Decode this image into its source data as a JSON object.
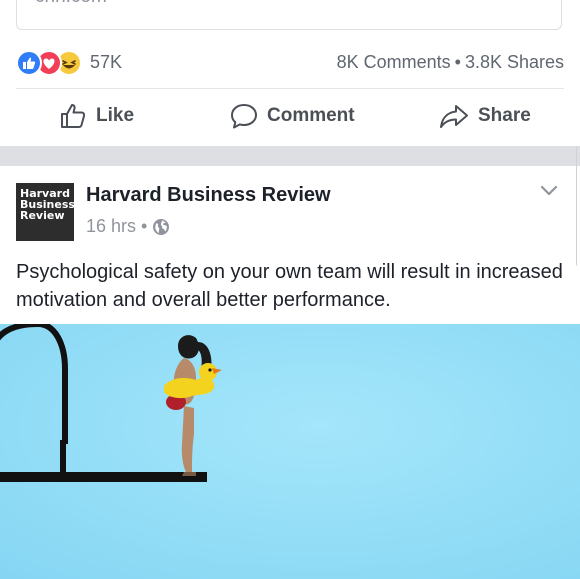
{
  "prev_post": {
    "link_domain": "cnn.com",
    "reaction_count": "57K",
    "comments": "8K Comments",
    "shares": "3.8K Shares",
    "stats_separator": "•"
  },
  "actions": {
    "like": "Like",
    "comment": "Comment",
    "share": "Share"
  },
  "post": {
    "logo_lines": [
      "Harvard",
      "Business",
      "Review"
    ],
    "page_name": "Harvard Business Review",
    "time": "16 hrs",
    "meta_separator": "•",
    "privacy_icon": "globe-icon",
    "text": "Psychological safety on your own team will result in increased motivation and overall better performance."
  },
  "colors": {
    "like_reaction": "#2f7ef7",
    "love_reaction": "#f33e58",
    "haha_reaction": "#f7c93d",
    "image_sky": "#8fdcf6"
  }
}
